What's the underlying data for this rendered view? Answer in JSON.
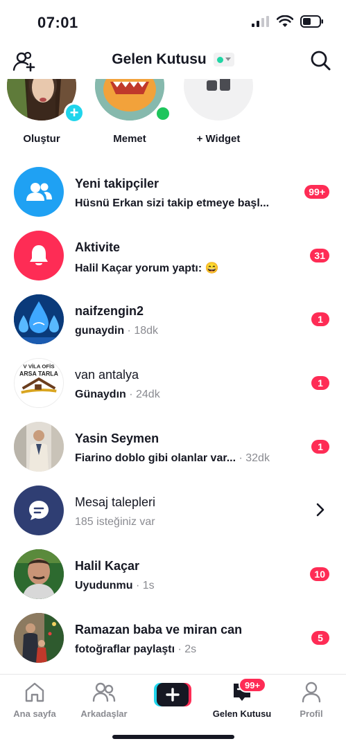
{
  "status_bar": {
    "time": "07:01"
  },
  "header": {
    "title": "Gelen Kutusu"
  },
  "stories": [
    {
      "label": "Oluştur"
    },
    {
      "label": "Memet"
    },
    {
      "label": "+ Widget"
    }
  ],
  "rows": [
    {
      "title": "Yeni takipçiler",
      "subtitle": "Hüsnü Erkan sizi takip etmeye başl...",
      "badge": "99+"
    },
    {
      "title": "Aktivite",
      "subtitle": "Halil Kaçar yorum yaptı: 😄",
      "badge": "31"
    },
    {
      "title": "naifzengin2",
      "subtitle": "gunaydin",
      "time": " · 18dk",
      "badge": "1"
    },
    {
      "title": "van antalya",
      "subtitle": "Günaydın",
      "time": " · 24dk",
      "badge": "1",
      "avatar_text_top": "V VİLA OFİS",
      "avatar_text_bottom": "ARSA TARLA"
    },
    {
      "title": "Yasin Seymen",
      "subtitle": "Fiarino doblo gibi olanlar var...",
      "time": " · 32dk",
      "badge": "1"
    },
    {
      "title": "Mesaj talepleri",
      "subtitle": "185 isteğiniz var"
    },
    {
      "title": "Halil Kaçar",
      "subtitle": "Uyudunmu",
      "time": " · 1s",
      "badge": "10"
    },
    {
      "title": "Ramazan baba ve miran can",
      "subtitle": "fotoğraflar paylaştı",
      "time": " · 2s",
      "badge": "5"
    }
  ],
  "bottom_nav": {
    "items": [
      {
        "label": "Ana sayfa"
      },
      {
        "label": "Arkadaşlar"
      },
      {
        "label": "Gelen Kutusu"
      },
      {
        "label": "Profil"
      }
    ],
    "inbox_badge": "99+"
  },
  "colors": {
    "accent": "#fe2c55",
    "cyan": "#20d5ec",
    "online": "#1ec55c",
    "followers_bg": "#1fa1f3",
    "activity_bg": "#fe2c55",
    "requests_bg": "#2f3e73"
  }
}
